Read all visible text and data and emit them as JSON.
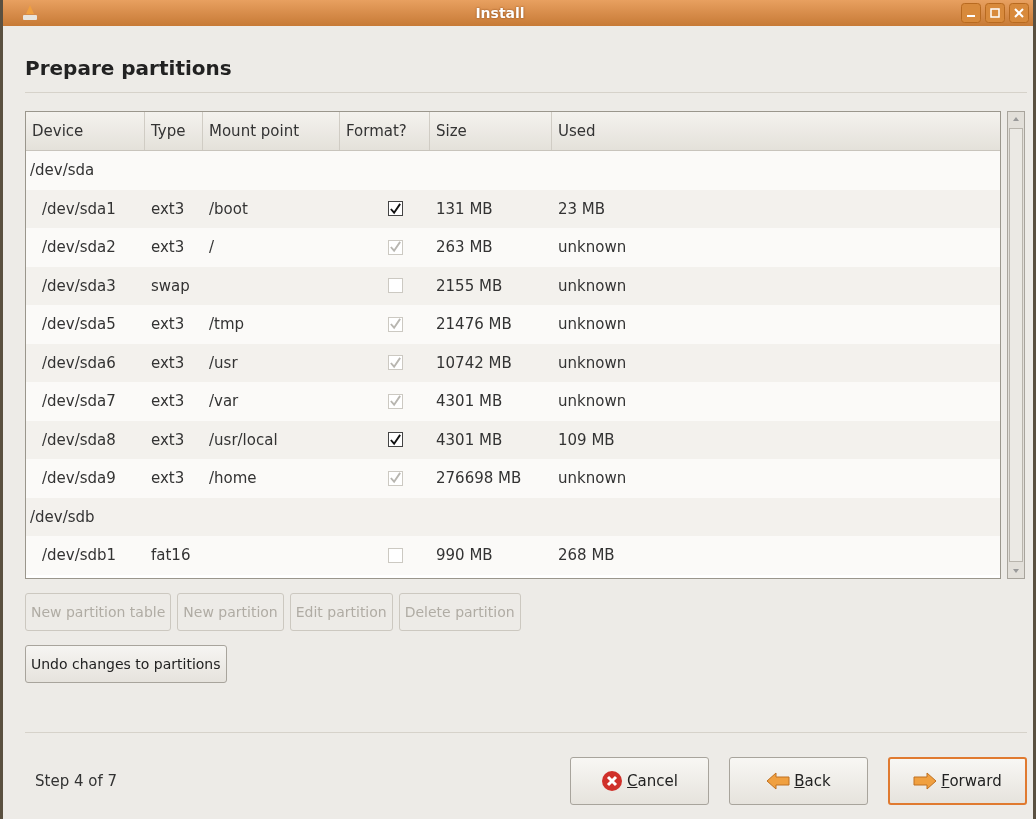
{
  "window": {
    "title": "Install"
  },
  "heading": "Prepare partitions",
  "table": {
    "columns": [
      "Device",
      "Type",
      "Mount point",
      "Format?",
      "Size",
      "Used"
    ],
    "rows": [
      {
        "kind": "disk",
        "device": "/dev/sda"
      },
      {
        "kind": "partition",
        "device": "/dev/sda1",
        "type": "ext3",
        "mount": "/boot",
        "format": {
          "checked": true,
          "disabled": false
        },
        "size": "131 MB",
        "used": "23 MB"
      },
      {
        "kind": "partition",
        "device": "/dev/sda2",
        "type": "ext3",
        "mount": "/",
        "format": {
          "checked": true,
          "disabled": true
        },
        "size": "263 MB",
        "used": "unknown"
      },
      {
        "kind": "partition",
        "device": "/dev/sda3",
        "type": "swap",
        "format": {
          "checked": false,
          "disabled": true
        },
        "size": "2155 MB",
        "used": "unknown"
      },
      {
        "kind": "partition",
        "device": "/dev/sda5",
        "type": "ext3",
        "mount": "/tmp",
        "format": {
          "checked": true,
          "disabled": true
        },
        "size": "21476 MB",
        "used": "unknown"
      },
      {
        "kind": "partition",
        "device": "/dev/sda6",
        "type": "ext3",
        "mount": "/usr",
        "format": {
          "checked": true,
          "disabled": true
        },
        "size": "10742 MB",
        "used": "unknown"
      },
      {
        "kind": "partition",
        "device": "/dev/sda7",
        "type": "ext3",
        "mount": "/var",
        "format": {
          "checked": true,
          "disabled": true
        },
        "size": "4301 MB",
        "used": "unknown"
      },
      {
        "kind": "partition",
        "device": "/dev/sda8",
        "type": "ext3",
        "mount": "/usr/local",
        "format": {
          "checked": true,
          "disabled": false
        },
        "size": "4301 MB",
        "used": "109 MB"
      },
      {
        "kind": "partition",
        "device": "/dev/sda9",
        "type": "ext3",
        "mount": "/home",
        "format": {
          "checked": true,
          "disabled": true
        },
        "size": "276698 MB",
        "used": "unknown"
      },
      {
        "kind": "disk",
        "device": "/dev/sdb"
      },
      {
        "kind": "partition",
        "device": "/dev/sdb1",
        "type": "fat16",
        "format": {
          "checked": false,
          "disabled": true
        },
        "size": "990 MB",
        "used": "268 MB"
      }
    ]
  },
  "partition_buttons": [
    {
      "label": "New partition table",
      "disabled": true
    },
    {
      "label": "New partition",
      "disabled": true
    },
    {
      "label": "Edit partition",
      "disabled": true
    },
    {
      "label": "Delete partition",
      "disabled": true
    }
  ],
  "undo_button": {
    "label": "Undo changes to partitions",
    "disabled": false
  },
  "step": "Step 4 of 7",
  "nav_buttons": [
    {
      "kind": "cancel",
      "label": "Cancel",
      "focused": false
    },
    {
      "kind": "back",
      "label": "Back",
      "focused": false
    },
    {
      "kind": "forward",
      "label": "Forward",
      "focused": true
    }
  ]
}
